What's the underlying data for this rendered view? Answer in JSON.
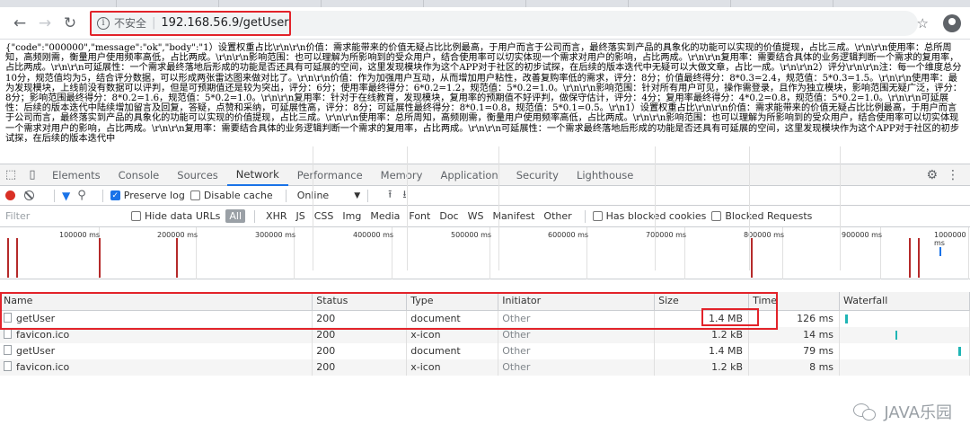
{
  "browser": {
    "insecure_label": "不安全",
    "url": "192.168.56.9/getUser"
  },
  "page_body_text": "{\"code\":\"000000\",\"message\":\"ok\",\"body\":\"1）设置权重占比\\r\\n\\r\\n价值：需求能带来的价值无疑占比比例最高，于用户而言于公司而言，最终落实到产品的具象化的功能可以实现的价值提现，占比三成。\\r\\n\\r\\n使用率：总所周知，高频刚需，衡量用户使用频率高低，占比两成。\\r\\n\\r\\n影响范围：也可以理解为所影响到的受众用户，结合使用率可以切实体现一个需求对用户的影响，占比两成。\\r\\n\\r\\n复用率：需要结合具体的业务逻辑判断一个需求的复用率，占比两成。\\r\\n\\r\\n可延展性：一个需求最终落地后形成的功能是否还具有可延展的空间，这里发现模块作为这个APP对于社区的初步试探，在后续的版本迭代中无疑可以大做文章，占比一成。\\r\\n\\r\\n2）评分\\r\\n\\r\\n注：每一个维度总分10分，规范值均为5，结合评分数据，可以形成两张雷达图来做对比了。\\r\\n\\r\\n价值：作为加强用户互动，从而增加用户粘性，改善复购率低的需求，评分：8分；价值最终得分：8*0.3=2.4，规范值：5*0.3=1.5。\\r\\n\\r\\n使用率：最为发现模块，上线前没有数据可以评判，但是可预期值还是较为突出，评分：6分；使用率最终得分：6*0.2=1.2，规范值：5*0.2=1.0。\\r\\n\\r\\n影响范围：针对所有用户可见，操作需登录，且作为独立模块，影响范围无疑广泛，评分：8分；影响范围最终得分：8*0.2=1.6，规范值：5*0.2=1.0。\\r\\n\\r\\n复用率：针对于在线教育，发现模块，复用率的预期值不好评判，做保守估计，评分：4分；复用率最终得分：4*0.2=0.8，规范值：5*0.2=1.0。\\r\\n\\r\\n可延展性：后续的版本迭代中陆续增加留言及回复，答疑，点赞和采纳，可延展性高，评分：8分；可延展性最终得分：8*0.1=0.8，规范值：5*0.1=0.5。\\r\\n1）设置权重占比\\r\\n\\r\\n价值：需求能带来的价值无疑占比比例最高，于用户而言于公司而言，最终落实到产品的具象化的功能可以实现的价值提现，占比三成。\\r\\n\\r\\n使用率：总所周知，高频刚需，衡量用户使用频率高低，占比两成。\\r\\n\\r\\n影响范围：也可以理解为所影响到的受众用户，结合使用率可以切实体现一个需求对用户的影响，占比两成。\\r\\n\\r\\n复用率：需要结合具体的业务逻辑判断一个需求的复用率，占比两成。\\r\\n\\r\\n可延展性：一个需求最终落地后形成的功能是否还具有可延展的空间，这里发现模块作为这个APP对于社区的初步试探，在后续的版本迭代中",
  "devtools": {
    "tabs": [
      "Elements",
      "Console",
      "Sources",
      "Network",
      "Performance",
      "Memory",
      "Application",
      "Security",
      "Lighthouse"
    ],
    "active_tab": "Network",
    "preserve_log": "Preserve log",
    "disable_cache": "Disable cache",
    "throttle": "Online",
    "filter_placeholder": "Filter",
    "hide_data_urls": "Hide data URLs",
    "types": [
      "All",
      "XHR",
      "JS",
      "CSS",
      "Img",
      "Media",
      "Font",
      "Doc",
      "WS",
      "Manifest",
      "Other"
    ],
    "has_blocked_cookies": "Has blocked cookies",
    "blocked_requests": "Blocked Requests",
    "overview_ticks": [
      "100000 ms",
      "200000 ms",
      "300000 ms",
      "400000 ms",
      "500000 ms",
      "600000 ms",
      "700000 ms",
      "800000 ms",
      "900000 ms",
      "1000000 ms"
    ],
    "columns": [
      "Name",
      "Status",
      "Type",
      "Initiator",
      "Size",
      "Time",
      "Waterfall"
    ],
    "rows": [
      {
        "name": "getUser",
        "status": "200",
        "type": "document",
        "initiator": "Other",
        "size": "1.4 MB",
        "time": "126 ms"
      },
      {
        "name": "favicon.ico",
        "status": "200",
        "type": "x-icon",
        "initiator": "Other",
        "size": "1.2 kB",
        "time": "14 ms"
      },
      {
        "name": "getUser",
        "status": "200",
        "type": "document",
        "initiator": "Other",
        "size": "1.4 MB",
        "time": "79 ms"
      },
      {
        "name": "favicon.ico",
        "status": "200",
        "type": "x-icon",
        "initiator": "Other",
        "size": "1.2 kB",
        "time": "8 ms"
      }
    ]
  },
  "watermark": "JAVA乐园"
}
